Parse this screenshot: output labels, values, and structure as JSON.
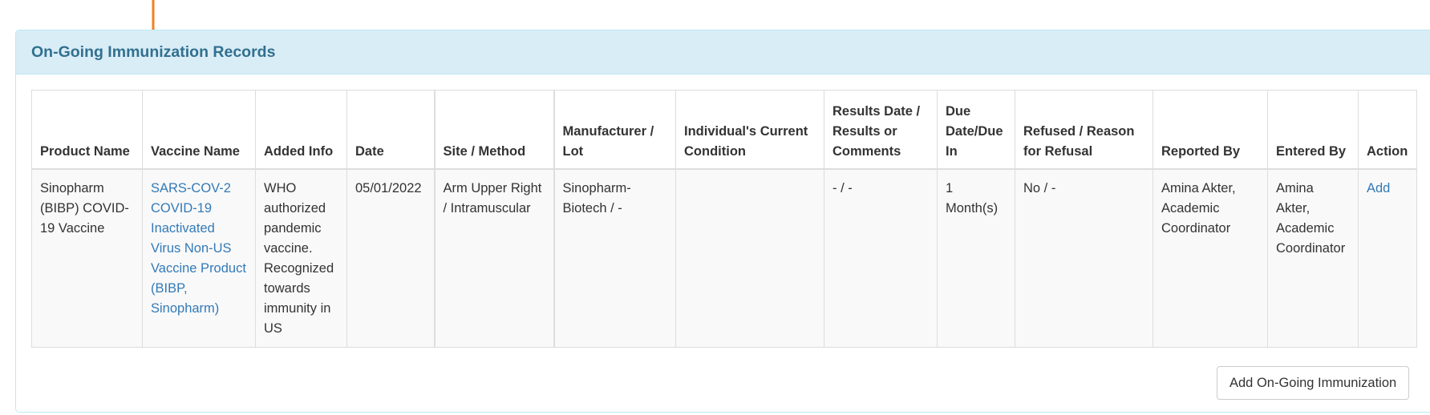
{
  "annotation": {
    "icon": "arrow-down-icon",
    "color": "#f08020"
  },
  "panel": {
    "title": "On-Going Immunization Records",
    "heading_bg": "#d9edf7",
    "heading_color": "#31708f",
    "border_color": "#bce8f1"
  },
  "table": {
    "columns": [
      "Product Name",
      "Vaccine Name",
      "Added Info",
      "Date",
      "Site / Method",
      "Manufacturer / Lot",
      "Individual's Current Condition",
      "Results Date / Results or Comments",
      "Due Date/Due In",
      "Refused / Reason for Refusal",
      "Reported By",
      "Entered By",
      "Action"
    ],
    "rows": [
      {
        "product_name": "Sinopharm (BIBP) COVID-19 Vaccine",
        "vaccine_name": "SARS-COV-2 COVID-19 Inactivated Virus Non-US Vaccine Product (BIBP, Sinopharm)",
        "added_info": "WHO authorized pandemic vaccine. Recognized towards immunity in US",
        "date": "05/01/2022",
        "site_method": "Arm Upper Right / Intramuscular",
        "manufacturer_lot": "Sinopharm-Biotech / -",
        "current_condition": "",
        "results": "- / -",
        "due": "1 Month(s)",
        "refused": "No / -",
        "reported_by": "Amina Akter, Academic Coordinator",
        "entered_by": "Amina Akter, Academic Coordinator",
        "action": "Add"
      }
    ]
  },
  "footer": {
    "add_button_label": "Add On-Going Immunization"
  },
  "colors": {
    "link": "#337ab7",
    "text": "#333333",
    "row_stripe": "#f9f9f9",
    "border": "#dddddd"
  }
}
